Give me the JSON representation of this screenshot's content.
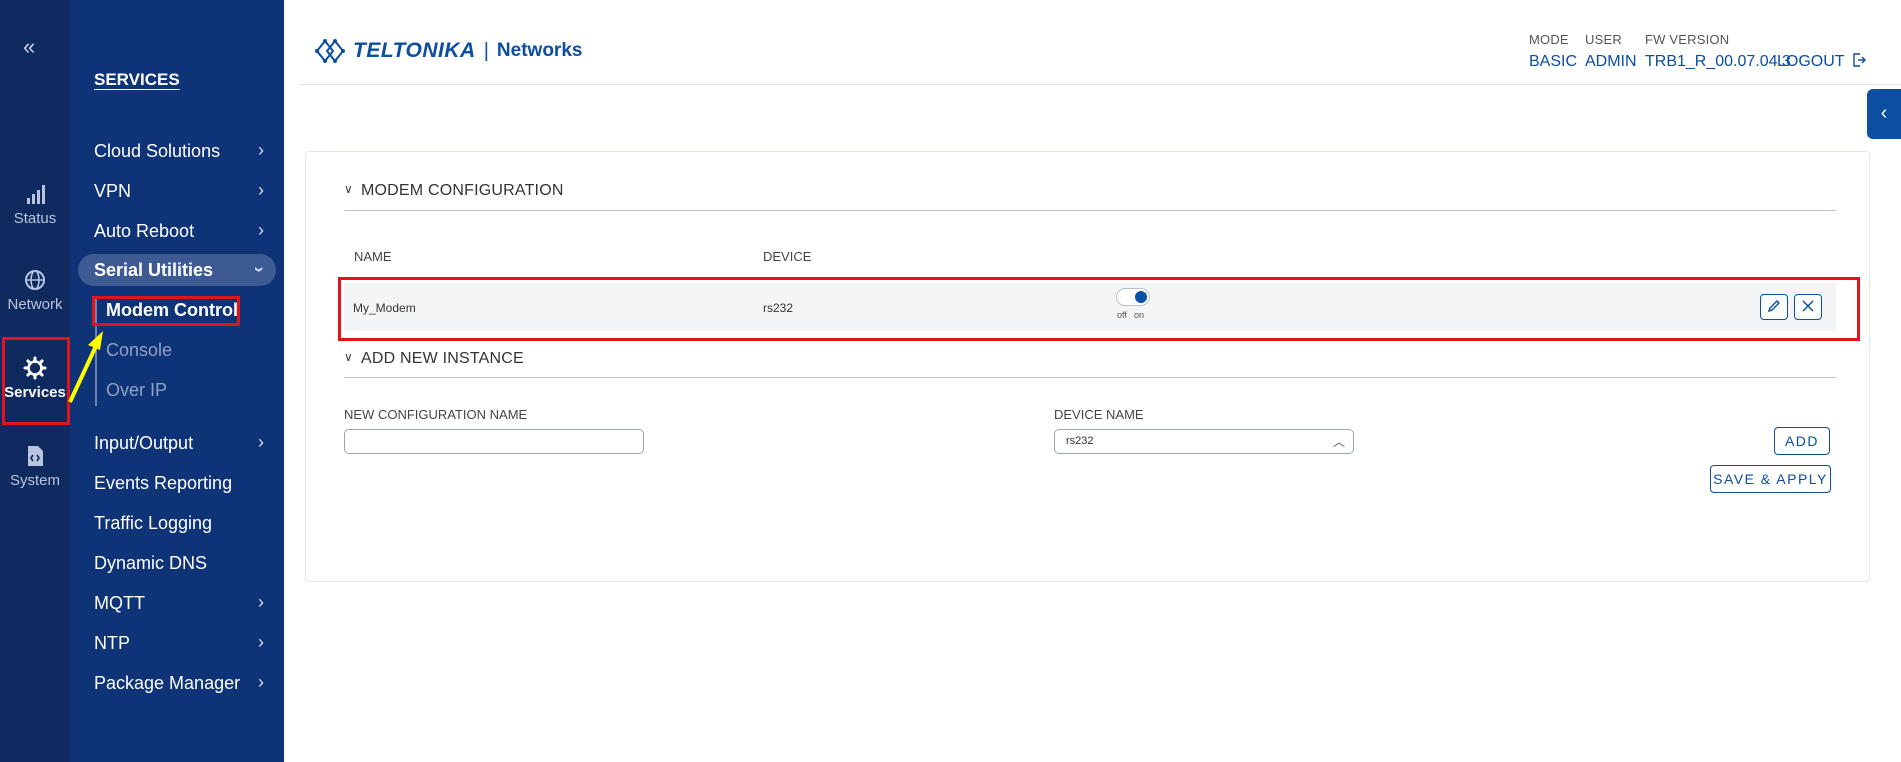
{
  "rail": {
    "collapse_glyph": "«",
    "items": [
      {
        "label": "Status",
        "icon": "signal-icon"
      },
      {
        "label": "Network",
        "icon": "globe-icon"
      },
      {
        "label": "Services",
        "icon": "gear-icon"
      },
      {
        "label": "System",
        "icon": "file-code-icon"
      }
    ]
  },
  "submenu": {
    "heading": "SERVICES",
    "items": [
      {
        "label": "Cloud Solutions"
      },
      {
        "label": "VPN"
      },
      {
        "label": "Auto Reboot"
      },
      {
        "label": "Serial Utilities"
      },
      {
        "label": "Input/Output"
      },
      {
        "label": "Events Reporting"
      },
      {
        "label": "Traffic Logging"
      },
      {
        "label": "Dynamic DNS"
      },
      {
        "label": "MQTT"
      },
      {
        "label": "NTP"
      },
      {
        "label": "Package Manager"
      }
    ],
    "serial_sub": [
      {
        "label": "Modem Control"
      },
      {
        "label": "Console"
      },
      {
        "label": "Over IP"
      }
    ]
  },
  "header": {
    "brand": "TELTONIKA",
    "separator": "|",
    "networks": "Networks",
    "mode_label": "MODE",
    "mode_value": "BASIC",
    "user_label": "USER",
    "user_value": "ADMIN",
    "fw_label": "FW VERSION",
    "fw_value": "TRB1_R_00.07.04.3",
    "logout": "LOGOUT"
  },
  "modem_config": {
    "title": "MODEM CONFIGURATION",
    "col_name": "NAME",
    "col_device": "DEVICE",
    "rows": [
      {
        "name": "My_Modem",
        "device": "rs232",
        "toggle_off": "off",
        "toggle_on": "on",
        "enabled": true
      }
    ]
  },
  "add_instance": {
    "title": "ADD NEW INSTANCE",
    "config_name_label": "NEW CONFIGURATION NAME",
    "config_name_value": "",
    "device_name_label": "DEVICE NAME",
    "device_name_value": "rs232",
    "add_button": "ADD",
    "save_button": "SAVE & APPLY"
  },
  "colors": {
    "rail_bg": "#0f2a5f",
    "submenu_bg": "#0e3377",
    "accent": "#0b4ea2",
    "highlight": "#e0141f",
    "arrow": "#ffff00"
  }
}
